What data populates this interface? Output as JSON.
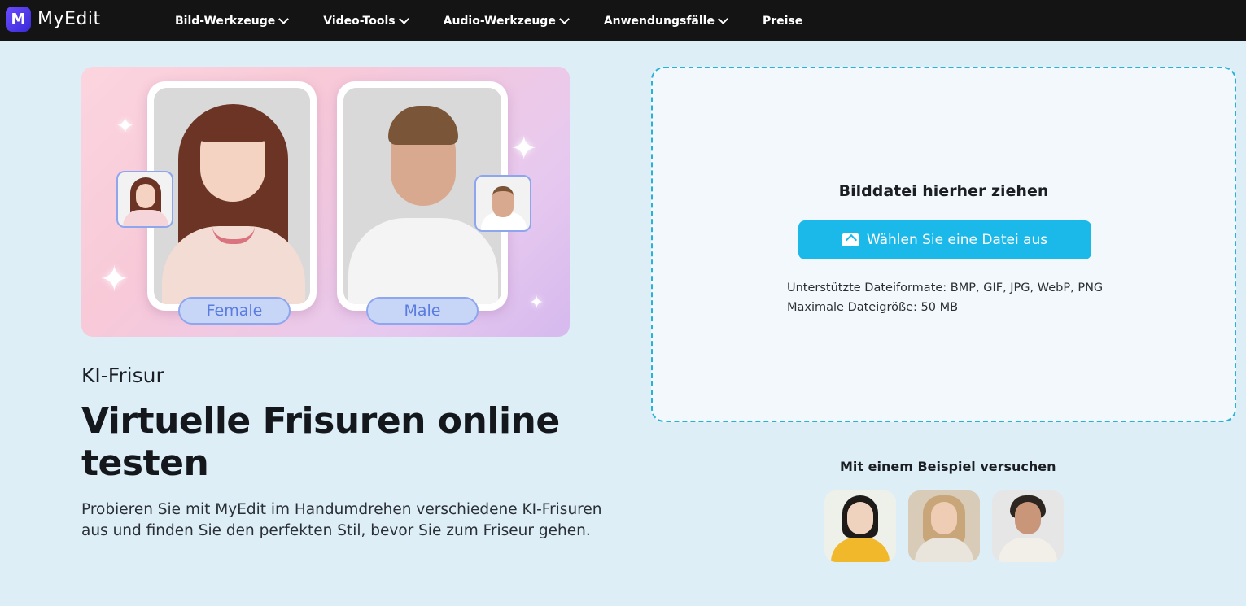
{
  "brand": {
    "name": "MyEdit",
    "logo_letter": "M",
    "accent": "#1bb9ea"
  },
  "nav": [
    {
      "label": "Bild-Werkzeuge",
      "dropdown": true
    },
    {
      "label": "Video-Tools",
      "dropdown": true
    },
    {
      "label": "Audio-Werkzeuge",
      "dropdown": true
    },
    {
      "label": "Anwendungsfälle",
      "dropdown": true
    },
    {
      "label": "Preise",
      "dropdown": false
    }
  ],
  "hero": {
    "female_label": "Female",
    "male_label": "Male"
  },
  "page": {
    "eyebrow": "KI-Frisur",
    "headline": "Virtuelle Frisuren online testen",
    "description": "Probieren Sie mit MyEdit im Handumdrehen verschiedene KI-Frisuren aus und finden Sie den perfekten Stil, bevor Sie zum Friseur gehen."
  },
  "upload": {
    "title": "Bilddatei hierher ziehen",
    "button_label": "Wählen Sie eine Datei aus",
    "formats": "Unterstützte Dateiformate: BMP, GIF, JPG, WebP, PNG",
    "max_size": "Maximale Dateigröße: 50 MB"
  },
  "examples": {
    "title": "Mit einem Beispiel versuchen"
  }
}
